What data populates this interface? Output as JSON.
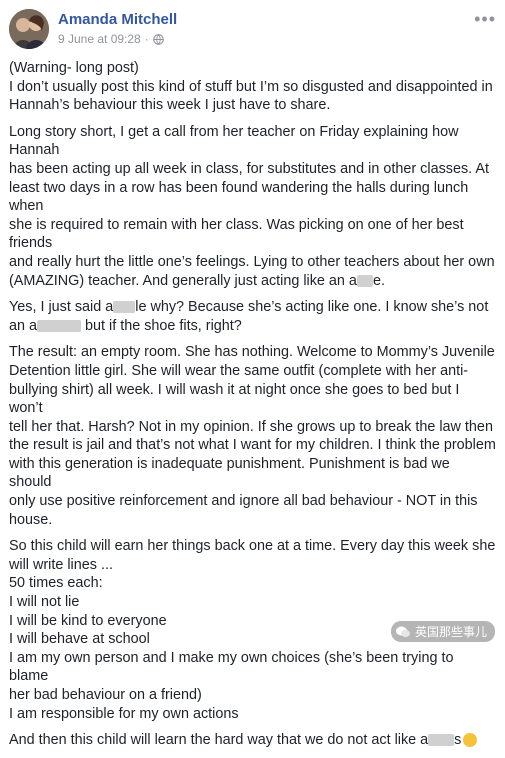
{
  "author": {
    "name": "Amanda Mitchell",
    "date": "9 June at 09:28",
    "separator": "·"
  },
  "icons": {
    "more": "more-options-icon",
    "audience": "globe-icon",
    "avatar": "profile-photo"
  },
  "post": {
    "p1": [
      "(Warning- long post)",
      "I don’t usually post this kind of stuff but I’m so disgusted and disappointed in",
      "Hannah’s behaviour this week I just have to share."
    ],
    "p2_lines": [
      "Long story short, I get a call from her teacher on Friday explaining how Hannah",
      "has been acting up all week in class, for substitutes and in other classes. At",
      "least two days in a row has been found wandering the halls during lunch when",
      "she is required to remain with her class. Was picking on one of her best friends",
      "and really hurt the little one’s feelings. Lying to other teachers about her own"
    ],
    "p2_last_a": "(AMAZING) teacher. And generally just acting like an a",
    "p2_last_b": "e.",
    "p3_a": "Yes, I just said a",
    "p3_b": "le why? Because she’s acting like one. I know she’s not",
    "p3_c": "an a",
    "p3_d": " but if the shoe fits, right?",
    "p4_lines": [
      "The result: an empty room. She has nothing. Welcome to Mommy’s Juvenile",
      "Detention little girl. She will wear the same outfit (complete with her anti-",
      "bullying shirt) all week. I will wash it at night once she goes to bed but I won’t",
      "tell her that. Harsh? Not in my opinion. If she grows up to break the law then",
      "the result is jail and that’s not what I want for my children. I think the problem",
      "with this generation is inadequate punishment. Punishment is bad we should",
      "only use positive reinforcement and ignore all bad behaviour - NOT in this",
      "house."
    ],
    "p5_lines": [
      "So this child will earn her things back one at a time. Every day this week she",
      "will write lines ...",
      "50 times each:",
      "I will not lie",
      "I will be kind to everyone",
      "I will behave at school",
      "I am my own person and I make my own choices (she’s been trying to blame",
      "her bad behaviour on a friend)",
      "I am responsible for my own actions"
    ],
    "p6_a": "And then this child will learn the hard way that we do not act like a",
    "p6_b": "s"
  },
  "watermark": {
    "text": "英国那些事儿"
  }
}
